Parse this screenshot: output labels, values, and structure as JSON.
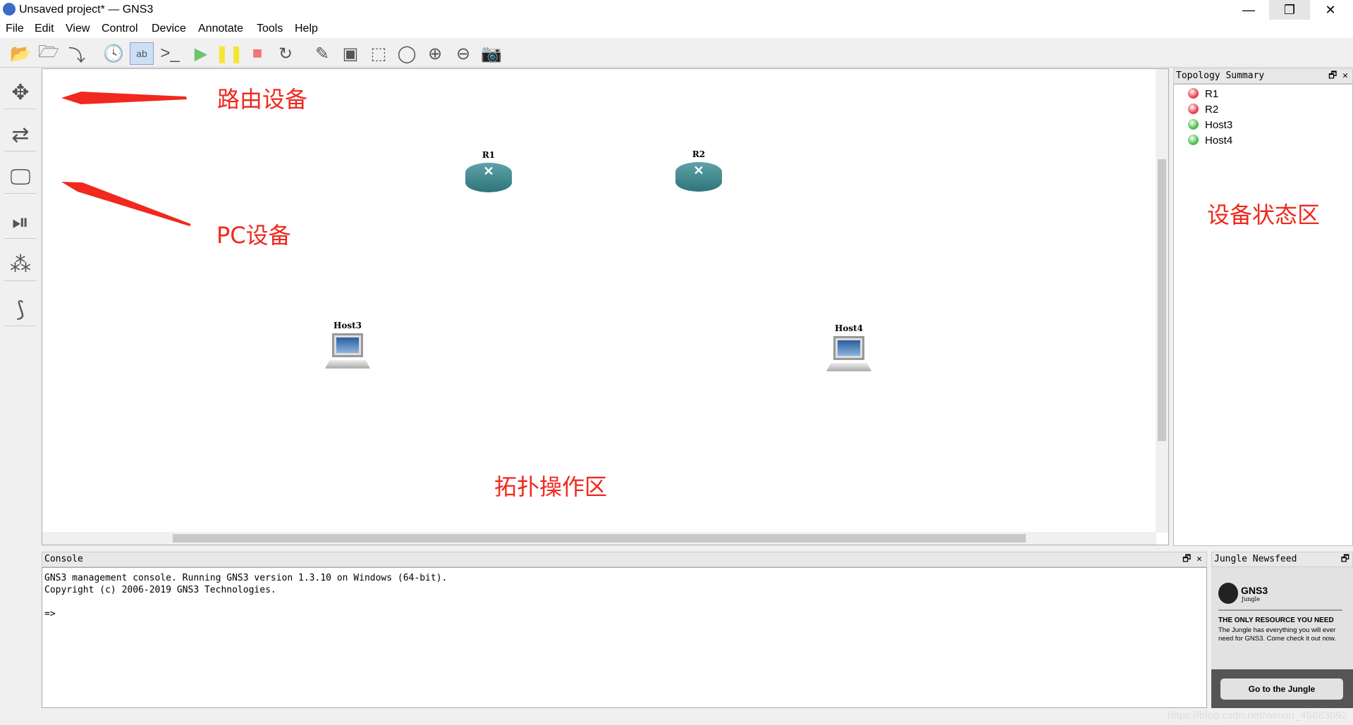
{
  "window": {
    "title": "Unsaved project* — GNS3",
    "minimize": "—",
    "restore": "❐",
    "close": "✕"
  },
  "menu": [
    "File",
    "Edit",
    "View",
    "Control",
    "Device",
    "Annotate",
    "Tools",
    "Help"
  ],
  "toolbar": [
    {
      "name": "new-project",
      "glyph": "📂"
    },
    {
      "name": "open-project",
      "glyph": "🗁"
    },
    {
      "name": "save-project",
      "glyph": "⤵"
    },
    {
      "name": "snapshot",
      "glyph": "🕓"
    },
    {
      "name": "show-interface-labels",
      "glyph": "ab"
    },
    {
      "name": "console-all",
      "glyph": ">_"
    },
    {
      "name": "start-all",
      "glyph": "▶",
      "color": "#6cc46c"
    },
    {
      "name": "suspend-all",
      "glyph": "❚❚",
      "color": "#f5e532"
    },
    {
      "name": "stop-all",
      "glyph": "■",
      "color": "#f27474"
    },
    {
      "name": "reload-all",
      "glyph": "↻"
    },
    {
      "name": "add-note",
      "glyph": "✎"
    },
    {
      "name": "insert-picture",
      "glyph": "▣"
    },
    {
      "name": "draw-rectangle",
      "glyph": "⬚"
    },
    {
      "name": "draw-ellipse",
      "glyph": "◯"
    },
    {
      "name": "zoom-in",
      "glyph": "⊕"
    },
    {
      "name": "zoom-out",
      "glyph": "⊖"
    },
    {
      "name": "screenshot",
      "glyph": "📷"
    }
  ],
  "devices": [
    {
      "name": "routers",
      "glyph": "✥"
    },
    {
      "name": "switches",
      "glyph": "⇄"
    },
    {
      "name": "end-devices",
      "glyph": "🖵"
    },
    {
      "name": "security-devices",
      "glyph": "⏯"
    },
    {
      "name": "all-devices",
      "glyph": "⁂"
    },
    {
      "name": "add-link",
      "glyph": "⟆"
    }
  ],
  "nodes": [
    {
      "label": "R1",
      "type": "router"
    },
    {
      "label": "R2",
      "type": "router"
    },
    {
      "label": "Host3",
      "type": "pc"
    },
    {
      "label": "Host4",
      "type": "pc"
    }
  ],
  "annotations": {
    "routers": "路由设备",
    "pc": "PC设备",
    "status": "设备状态区",
    "topology": "拓扑操作区",
    "color": "#f0281e"
  },
  "topology_summary": {
    "title": "Topology Summary",
    "items": [
      {
        "label": "R1",
        "status": "stopped",
        "color": "#e8424a"
      },
      {
        "label": "R2",
        "status": "stopped",
        "color": "#e8424a"
      },
      {
        "label": "Host3",
        "status": "started",
        "color": "#4cbf4c"
      },
      {
        "label": "Host4",
        "status": "started",
        "color": "#4cbf4c"
      }
    ]
  },
  "console": {
    "title": "Console",
    "line1": "GNS3 management console. Running GNS3 version 1.3.10 on Windows (64-bit).",
    "line2": "Copyright (c) 2006-2019 GNS3 Technologies.",
    "prompt": "=>"
  },
  "jungle": {
    "title": "Jungle Newsfeed",
    "logo": "GNS3",
    "logo_sub": "Jungle",
    "headline": "THE ONLY RESOURCE YOU NEED",
    "body": "The Jungle has everything you will ever need for GNS3. Come check it out now.",
    "button": "Go to the Jungle"
  },
  "watermark": "https://blog.csdn.net/weixin_45683092"
}
